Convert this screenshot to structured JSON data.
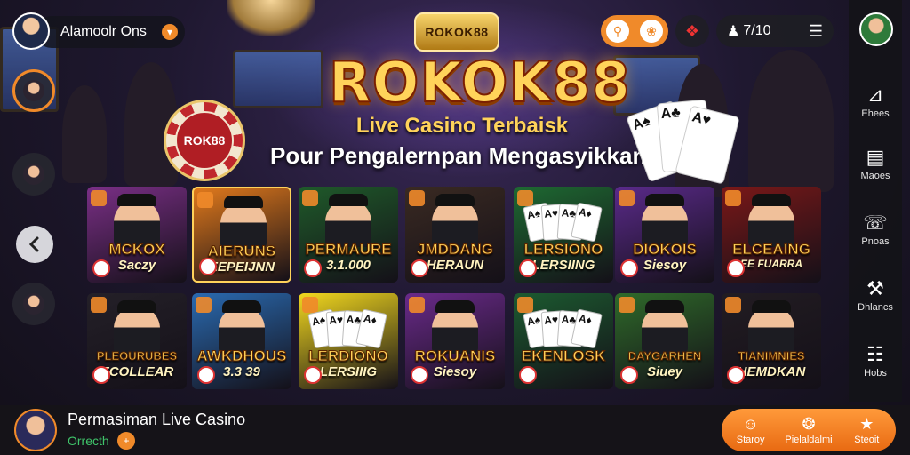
{
  "header": {
    "account_label": "Alamoolr Ons",
    "account_dropdown_icon": "chevron-down-icon",
    "balance": "7/10",
    "user_icon": "user-icon",
    "menu_icon": "menu-icon",
    "gift_icon": "gift-icon"
  },
  "logo": {
    "badge_text": "ROKOK88",
    "title": "ROKOK88",
    "subtitle": "Live Casino Terbaisk",
    "headline": "Pour Pengalernpan Mengasyikkan"
  },
  "chip_text": "ROK88",
  "cards_fan": [
    "A♠",
    "A♣",
    "A♥"
  ],
  "sidebar_right": {
    "items": [
      {
        "label": "Ehees",
        "icon": "hanger-icon"
      },
      {
        "label": "Maoes",
        "icon": "stack-icon"
      },
      {
        "label": "Pnoas",
        "icon": "phone-icon"
      },
      {
        "label": "Dhlancs",
        "icon": "tools-icon"
      },
      {
        "label": "Hobs",
        "icon": "list-icon"
      }
    ]
  },
  "games": [
    {
      "t1": "MCKOX",
      "t2": "Saczy",
      "bg": "#7a2f86"
    },
    {
      "t1": "AIERUNS",
      "t2": "EEPEIJNN",
      "bg": "#e0791c"
    },
    {
      "t1": "PERMAURE",
      "t2": "3.1.000",
      "bg": "#1f5a2a"
    },
    {
      "t1": "JMDDANG",
      "t2": "HERAUN",
      "bg": "#3a2a22"
    },
    {
      "t1": "",
      "t2": "",
      "bg": "#1e6a32"
    },
    {
      "t1": "DIOKOIS",
      "t2": "Siesoy",
      "bg": "#5a2a8a"
    },
    {
      "t1": "ELCEAING",
      "t2": "EE FUARRA",
      "bg": "#7a1818"
    },
    {
      "t1": "PLEOURUBES",
      "t2": "ECOLLEAR",
      "bg": "#242028"
    },
    {
      "t1": "AWKDHOUS",
      "t2": "3.3 39",
      "bg": "#2a6ab0"
    },
    {
      "t1": "LERDIONO",
      "t2": "LERSIIIG",
      "bg": "#f2d81e"
    },
    {
      "t1": "ROKUANIS",
      "t2": "Siesoy",
      "bg": "#6a2a8a"
    },
    {
      "t1": "EKENLOSK",
      "t2": "",
      "bg": "#1c5a30"
    },
    {
      "t1": "DAYGARHEN",
      "t2": "Siuey",
      "bg": "#2f6a2a"
    },
    {
      "t1": "TIANIMNIES",
      "t2": "HEMDKAN",
      "bg": "#221c22"
    }
  ],
  "tile4_texts": {
    "t1": "LERSIONO",
    "t2": "LERSIING"
  },
  "bottom": {
    "title": "Permasiman Live Casino",
    "subtitle": "Orrecth",
    "actions": [
      {
        "label": "Staroy",
        "icon": "profile-icon"
      },
      {
        "label": "Pielaldalmi",
        "icon": "chip-icon"
      },
      {
        "label": "Steoit",
        "icon": "star-icon"
      }
    ]
  },
  "colors": {
    "accent": "#f08a2a",
    "gold": "#ffd35a",
    "online": "#3fc46a"
  }
}
